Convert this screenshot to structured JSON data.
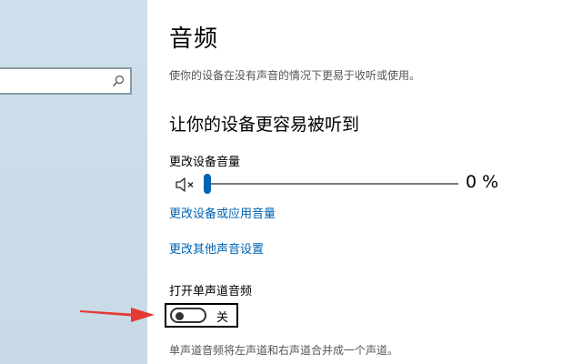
{
  "page": {
    "title": "音频",
    "description": "使你的设备在没有声音的情况下更易于收听或使用。"
  },
  "sidebar": {
    "search": {
      "placeholder": "",
      "icon": "search-icon"
    }
  },
  "section": {
    "title": "让你的设备更容易被听到",
    "volume_label": "更改设备音量",
    "volume_icon": "speaker-muted-icon",
    "volume_percent": 0,
    "volume_value_text": "0 %",
    "link_app_volume": "更改设备或应用音量",
    "link_other_sound": "更改其他声音设置"
  },
  "mono": {
    "label": "打开单声道音频",
    "toggle_on": false,
    "toggle_state_text": "关",
    "description": "单声道音频将左声道和右声道合并成一个声道。"
  },
  "colors": {
    "accent": "#0063b1",
    "annotation_arrow": "#e53935"
  }
}
